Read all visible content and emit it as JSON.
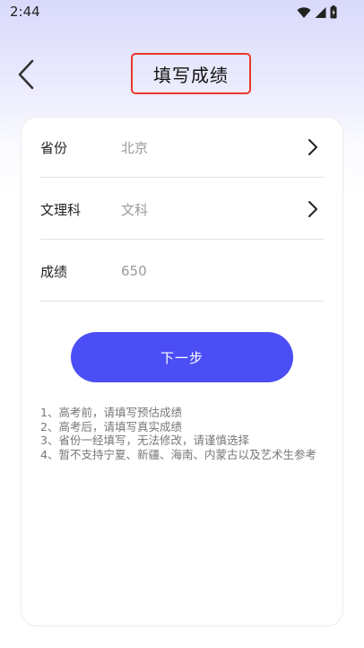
{
  "status_bar": {
    "time": "2:44",
    "icons": [
      "wifi-icon",
      "signal-icon",
      "battery-icon"
    ]
  },
  "header": {
    "back_icon": "chevron-left-icon",
    "title": "填写成绩",
    "title_highlight_color": "#e8382c"
  },
  "form": {
    "rows": [
      {
        "label": "省份",
        "value": "北京",
        "has_chevron": true
      },
      {
        "label": "文理科",
        "value": "文科",
        "has_chevron": true
      },
      {
        "label": "成绩",
        "value": "650",
        "has_chevron": false
      }
    ]
  },
  "next_button": {
    "label": "下一步",
    "color": "#4b4ef4"
  },
  "notes": [
    "1、高考前，请填写预估成绩",
    "2、高考后，请填写真实成绩",
    "3、省份一经填写，无法修改，请谨慎选择",
    "4、暂不支持宁夏、新疆、海南、内蒙古以及艺术生参考"
  ]
}
